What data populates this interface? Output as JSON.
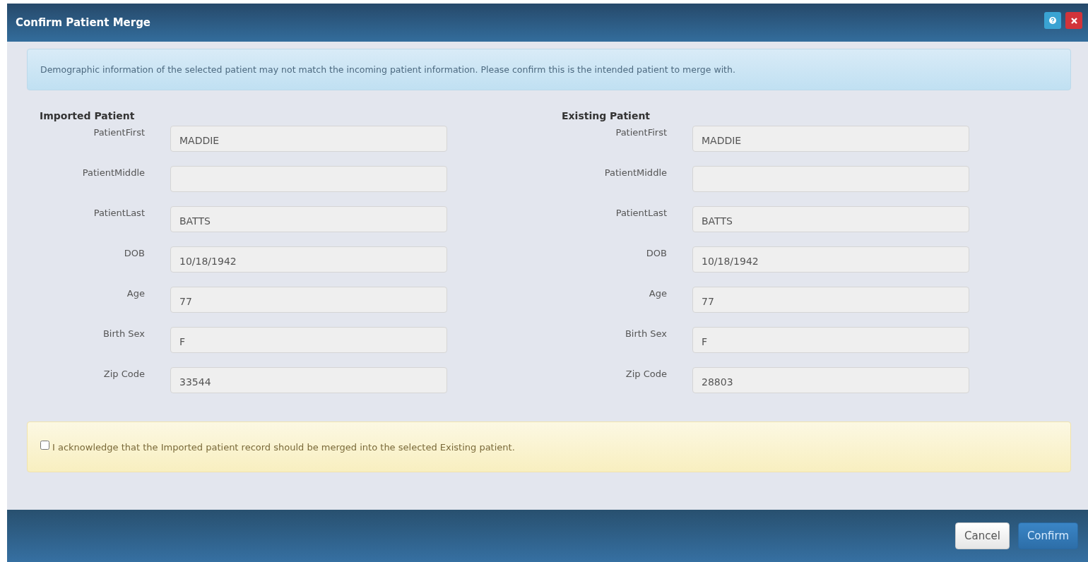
{
  "window": {
    "title": "Confirm Patient Merge"
  },
  "alert": {
    "text": "Demographic information of the selected patient may not match the incoming patient information. Please confirm this is the intended patient to merge with."
  },
  "patients": [
    {
      "heading": "Imported Patient",
      "fields": [
        {
          "label": "PatientFirst",
          "value": "MADDIE"
        },
        {
          "label": "PatientMiddle"
        },
        {
          "label": "PatientLast",
          "value": "BATTS"
        },
        {
          "label": "DOB",
          "value": "10/18/1942"
        },
        {
          "label": "Age",
          "value": "77"
        },
        {
          "label": "Birth Sex",
          "value": "F"
        },
        {
          "label": "Zip Code",
          "value": "33544"
        }
      ]
    },
    {
      "heading": "Existing Patient",
      "fields": [
        {
          "label": "PatientFirst",
          "value": "MADDIE"
        },
        {
          "label": "PatientMiddle"
        },
        {
          "label": "PatientLast",
          "value": "BATTS"
        },
        {
          "label": "DOB",
          "value": "10/18/1942"
        },
        {
          "label": "Age",
          "value": "77"
        },
        {
          "label": "Birth Sex",
          "value": "F"
        },
        {
          "label": "Zip Code",
          "value": "28803"
        }
      ]
    }
  ],
  "acknowledge": {
    "text": "I acknowledge that the Imported patient record should be merged into the selected Existing patient.",
    "checked": false
  },
  "buttons": [
    {
      "label": "Cancel",
      "kind": "secondary"
    },
    {
      "label": "Confirm",
      "kind": "primary"
    }
  ]
}
